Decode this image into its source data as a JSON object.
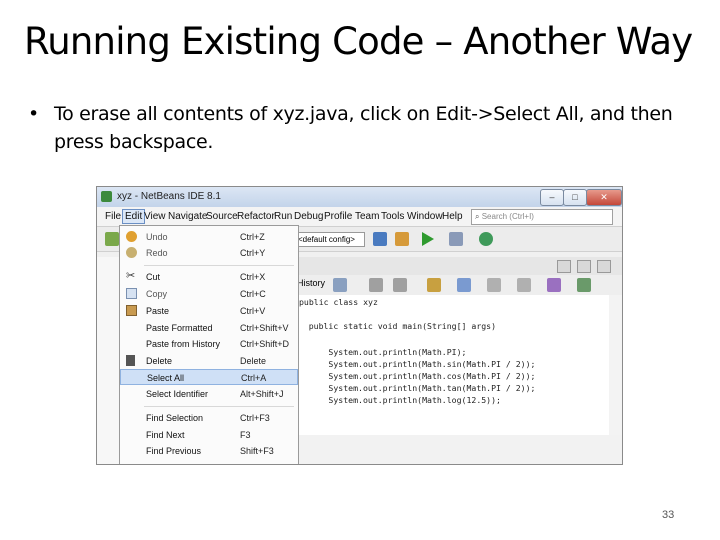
{
  "slide": {
    "title": "Running Existing Code – Another Way",
    "bullet_marker": "•",
    "bullet": "To erase all contents of xyz.java, click on Edit->Select All, and then press backspace.",
    "page_number": "33"
  },
  "window": {
    "title": "xyz - NetBeans IDE 8.1",
    "controls": [
      "–",
      "□",
      "✕"
    ],
    "menus": [
      "File",
      "Edit",
      "View",
      "Navigate",
      "Source",
      "Refactor",
      "Run",
      "Debug",
      "Profile",
      "Team",
      "Tools",
      "Window",
      "Help"
    ],
    "search_placeholder": "Search (Ctrl+I)",
    "config_combo": "<default config>",
    "history_tab": "History",
    "code": [
      "public class xyz",
      "    public static void main(String[] args)",
      "        System.out.println(Math.PI);",
      "        System.out.println(Math.sin(Math.PI / 2));",
      "        System.out.println(Math.cos(Math.PI / 2));",
      "        System.out.println(Math.tan(Math.PI / 2));",
      "        System.out.println(Math.log(12.5));"
    ]
  },
  "edit_menu": {
    "items": [
      {
        "label": "Undo",
        "accel": "Ctrl+Z",
        "icon": "undo-icon",
        "enabled": false
      },
      {
        "label": "Redo",
        "accel": "Ctrl+Y",
        "icon": "redo-icon",
        "enabled": false
      },
      {
        "label": "Cut",
        "accel": "Ctrl+X",
        "icon": "scissors-icon",
        "enabled": true
      },
      {
        "label": "Copy",
        "accel": "Ctrl+C",
        "icon": "copy-icon",
        "enabled": false
      },
      {
        "label": "Paste",
        "accel": "Ctrl+V",
        "icon": "paste-icon",
        "enabled": true
      },
      {
        "label": "Paste Formatted",
        "accel": "Ctrl+Shift+V",
        "icon": "",
        "enabled": true
      },
      {
        "label": "Paste from History",
        "accel": "Ctrl+Shift+D",
        "icon": "",
        "enabled": true
      },
      {
        "label": "Delete",
        "accel": "Delete",
        "icon": "delete-icon",
        "enabled": true
      },
      {
        "label": "Select All",
        "accel": "Ctrl+A",
        "icon": "",
        "enabled": true,
        "selected": true
      },
      {
        "label": "Select Identifier",
        "accel": "Alt+Shift+J",
        "icon": "",
        "enabled": true
      },
      {
        "label": "Find Selection",
        "accel": "Ctrl+F3",
        "icon": "",
        "enabled": true
      },
      {
        "label": "Find Next",
        "accel": "F3",
        "icon": "",
        "enabled": true
      },
      {
        "label": "Find Previous",
        "accel": "Shift+F3",
        "icon": "",
        "enabled": true
      }
    ]
  }
}
